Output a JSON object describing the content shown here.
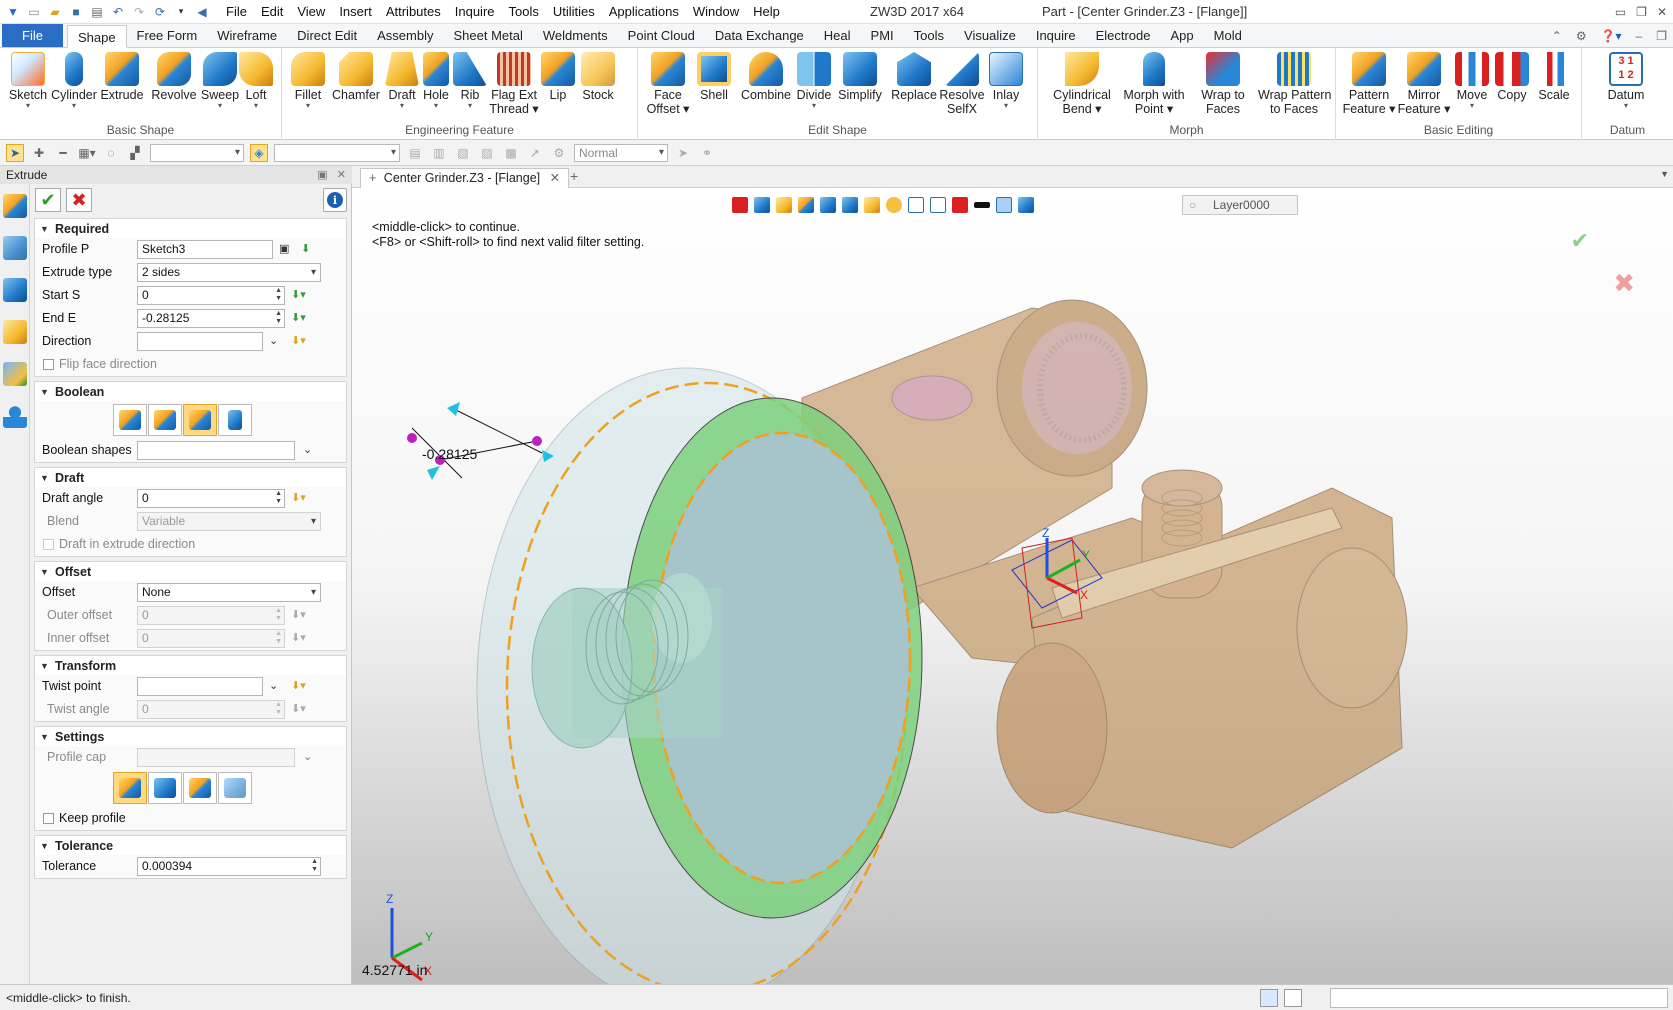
{
  "titlebar": {
    "menus": [
      "File",
      "Edit",
      "View",
      "Insert",
      "Attributes",
      "Inquire",
      "Tools",
      "Utilities",
      "Applications",
      "Window",
      "Help"
    ],
    "app_title": "ZW3D 2017  x64",
    "doc_title": "Part - [Center Grinder.Z3 - [Flange]]"
  },
  "ribbon_tabs": [
    "File",
    "Shape",
    "Free Form",
    "Wireframe",
    "Direct Edit",
    "Assembly",
    "Sheet Metal",
    "Weldments",
    "Point Cloud",
    "Data Exchange",
    "Heal",
    "PMI",
    "Tools",
    "Visualize",
    "Inquire",
    "Electrode",
    "App",
    "Mold"
  ],
  "active_tab": "Shape",
  "ribbon_groups": [
    {
      "title": "Basic Shape",
      "buttons": [
        "Sketch",
        "Cylinder",
        "Extrude",
        "Revolve",
        "Sweep",
        "Loft"
      ]
    },
    {
      "title": "Engineering Feature",
      "buttons": [
        "Fillet",
        "Chamfer",
        "Draft",
        "Hole",
        "Rib",
        "Flag Ext Thread",
        "Lip",
        "Stock"
      ]
    },
    {
      "title": "Edit Shape",
      "buttons": [
        "Face Offset",
        "Shell",
        "Combine",
        "Divide",
        "Simplify",
        "Replace",
        "Resolve SelfX",
        "Inlay"
      ]
    },
    {
      "title": "Morph",
      "buttons": [
        "Cylindrical Bend",
        "Morph with Point",
        "Wrap to Faces",
        "Wrap Pattern to Faces"
      ]
    },
    {
      "title": "Basic Editing",
      "buttons": [
        "Pattern Feature",
        "Mirror Feature",
        "Move",
        "Copy",
        "Scale"
      ]
    },
    {
      "title": "Datum",
      "buttons": [
        "Datum"
      ]
    }
  ],
  "toolbar2": {
    "style_combo": "Normal"
  },
  "panel": {
    "title": "Extrude",
    "required": {
      "title": "Required",
      "profile_label": "Profile P",
      "profile_value": "Sketch3",
      "extrude_type_label": "Extrude type",
      "extrude_type_value": "2 sides",
      "start_label": "Start S",
      "start_value": "0",
      "end_label": "End E",
      "end_value": "-0.28125",
      "direction_label": "Direction",
      "direction_value": "",
      "flip_label": "Flip face direction"
    },
    "boolean": {
      "title": "Boolean",
      "shapes_label": "Boolean shapes",
      "shapes_value": ""
    },
    "draft": {
      "title": "Draft",
      "angle_label": "Draft angle",
      "angle_value": "0",
      "blend_label": "Blend",
      "blend_value": "Variable",
      "in_dir_label": "Draft in extrude direction"
    },
    "offset": {
      "title": "Offset",
      "offset_label": "Offset",
      "offset_value": "None",
      "outer_label": "Outer offset",
      "outer_value": "0",
      "inner_label": "Inner offset",
      "inner_value": "0"
    },
    "transform": {
      "title": "Transform",
      "twist_point_label": "Twist point",
      "twist_point_value": "",
      "twist_angle_label": "Twist angle",
      "twist_angle_value": "0"
    },
    "settings": {
      "title": "Settings",
      "profile_cap_label": "Profile cap",
      "profile_cap_value": "",
      "keep_profile_label": "Keep profile"
    },
    "tolerance": {
      "title": "Tolerance",
      "tolerance_label": "Tolerance",
      "tolerance_value": "0.000394"
    }
  },
  "document_tab": "Center Grinder.Z3 - [Flange]",
  "viewport": {
    "layer": "Layer0000",
    "hint_line1": "<middle-click> to continue.",
    "hint_line2": "<F8> or <Shift-roll> to find next valid filter setting.",
    "dimension_value": "-0.28125",
    "measure": "4.52771 in",
    "axis_x": "X",
    "axis_y": "Y",
    "axis_z": "Z"
  },
  "statusbar": {
    "text": "<middle-click> to finish."
  },
  "colors": {
    "accent": "#2b6cc4",
    "ok_green": "#2aa02a",
    "cancel_red": "#d42020",
    "model_copper": "#c8a072",
    "model_green": "#7ed17e",
    "model_glass": "#cfe4e8",
    "edge_orange": "#f0a020"
  }
}
